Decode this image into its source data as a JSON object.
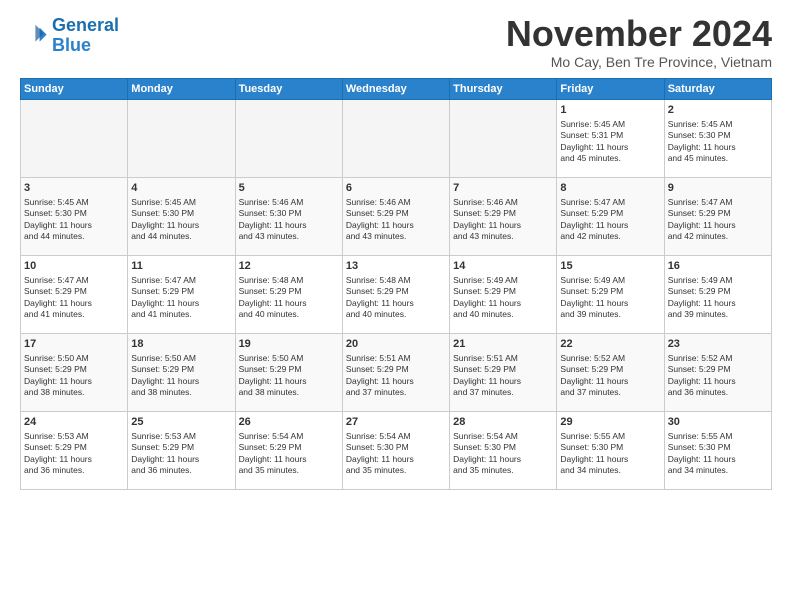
{
  "logo": {
    "line1": "General",
    "line2": "Blue"
  },
  "title": "November 2024",
  "location": "Mo Cay, Ben Tre Province, Vietnam",
  "weekdays": [
    "Sunday",
    "Monday",
    "Tuesday",
    "Wednesday",
    "Thursday",
    "Friday",
    "Saturday"
  ],
  "weeks": [
    [
      {
        "day": "",
        "info": ""
      },
      {
        "day": "",
        "info": ""
      },
      {
        "day": "",
        "info": ""
      },
      {
        "day": "",
        "info": ""
      },
      {
        "day": "",
        "info": ""
      },
      {
        "day": "1",
        "info": "Sunrise: 5:45 AM\nSunset: 5:31 PM\nDaylight: 11 hours\nand 45 minutes."
      },
      {
        "day": "2",
        "info": "Sunrise: 5:45 AM\nSunset: 5:30 PM\nDaylight: 11 hours\nand 45 minutes."
      }
    ],
    [
      {
        "day": "3",
        "info": "Sunrise: 5:45 AM\nSunset: 5:30 PM\nDaylight: 11 hours\nand 44 minutes."
      },
      {
        "day": "4",
        "info": "Sunrise: 5:45 AM\nSunset: 5:30 PM\nDaylight: 11 hours\nand 44 minutes."
      },
      {
        "day": "5",
        "info": "Sunrise: 5:46 AM\nSunset: 5:30 PM\nDaylight: 11 hours\nand 43 minutes."
      },
      {
        "day": "6",
        "info": "Sunrise: 5:46 AM\nSunset: 5:29 PM\nDaylight: 11 hours\nand 43 minutes."
      },
      {
        "day": "7",
        "info": "Sunrise: 5:46 AM\nSunset: 5:29 PM\nDaylight: 11 hours\nand 43 minutes."
      },
      {
        "day": "8",
        "info": "Sunrise: 5:47 AM\nSunset: 5:29 PM\nDaylight: 11 hours\nand 42 minutes."
      },
      {
        "day": "9",
        "info": "Sunrise: 5:47 AM\nSunset: 5:29 PM\nDaylight: 11 hours\nand 42 minutes."
      }
    ],
    [
      {
        "day": "10",
        "info": "Sunrise: 5:47 AM\nSunset: 5:29 PM\nDaylight: 11 hours\nand 41 minutes."
      },
      {
        "day": "11",
        "info": "Sunrise: 5:47 AM\nSunset: 5:29 PM\nDaylight: 11 hours\nand 41 minutes."
      },
      {
        "day": "12",
        "info": "Sunrise: 5:48 AM\nSunset: 5:29 PM\nDaylight: 11 hours\nand 40 minutes."
      },
      {
        "day": "13",
        "info": "Sunrise: 5:48 AM\nSunset: 5:29 PM\nDaylight: 11 hours\nand 40 minutes."
      },
      {
        "day": "14",
        "info": "Sunrise: 5:49 AM\nSunset: 5:29 PM\nDaylight: 11 hours\nand 40 minutes."
      },
      {
        "day": "15",
        "info": "Sunrise: 5:49 AM\nSunset: 5:29 PM\nDaylight: 11 hours\nand 39 minutes."
      },
      {
        "day": "16",
        "info": "Sunrise: 5:49 AM\nSunset: 5:29 PM\nDaylight: 11 hours\nand 39 minutes."
      }
    ],
    [
      {
        "day": "17",
        "info": "Sunrise: 5:50 AM\nSunset: 5:29 PM\nDaylight: 11 hours\nand 38 minutes."
      },
      {
        "day": "18",
        "info": "Sunrise: 5:50 AM\nSunset: 5:29 PM\nDaylight: 11 hours\nand 38 minutes."
      },
      {
        "day": "19",
        "info": "Sunrise: 5:50 AM\nSunset: 5:29 PM\nDaylight: 11 hours\nand 38 minutes."
      },
      {
        "day": "20",
        "info": "Sunrise: 5:51 AM\nSunset: 5:29 PM\nDaylight: 11 hours\nand 37 minutes."
      },
      {
        "day": "21",
        "info": "Sunrise: 5:51 AM\nSunset: 5:29 PM\nDaylight: 11 hours\nand 37 minutes."
      },
      {
        "day": "22",
        "info": "Sunrise: 5:52 AM\nSunset: 5:29 PM\nDaylight: 11 hours\nand 37 minutes."
      },
      {
        "day": "23",
        "info": "Sunrise: 5:52 AM\nSunset: 5:29 PM\nDaylight: 11 hours\nand 36 minutes."
      }
    ],
    [
      {
        "day": "24",
        "info": "Sunrise: 5:53 AM\nSunset: 5:29 PM\nDaylight: 11 hours\nand 36 minutes."
      },
      {
        "day": "25",
        "info": "Sunrise: 5:53 AM\nSunset: 5:29 PM\nDaylight: 11 hours\nand 36 minutes."
      },
      {
        "day": "26",
        "info": "Sunrise: 5:54 AM\nSunset: 5:29 PM\nDaylight: 11 hours\nand 35 minutes."
      },
      {
        "day": "27",
        "info": "Sunrise: 5:54 AM\nSunset: 5:30 PM\nDaylight: 11 hours\nand 35 minutes."
      },
      {
        "day": "28",
        "info": "Sunrise: 5:54 AM\nSunset: 5:30 PM\nDaylight: 11 hours\nand 35 minutes."
      },
      {
        "day": "29",
        "info": "Sunrise: 5:55 AM\nSunset: 5:30 PM\nDaylight: 11 hours\nand 34 minutes."
      },
      {
        "day": "30",
        "info": "Sunrise: 5:55 AM\nSunset: 5:30 PM\nDaylight: 11 hours\nand 34 minutes."
      }
    ]
  ]
}
